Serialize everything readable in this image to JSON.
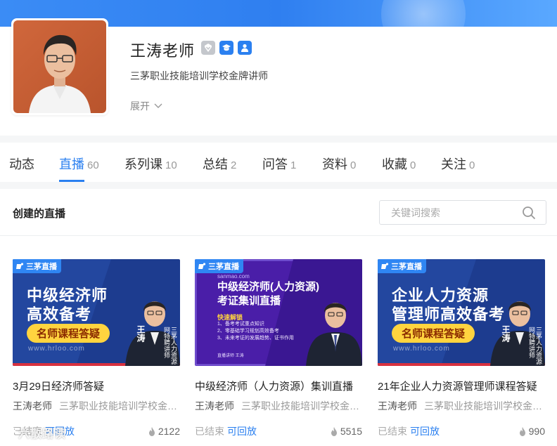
{
  "profile": {
    "name": "王涛老师",
    "bio": "三茅职业技能培训学校金牌讲师",
    "expand_label": "展开"
  },
  "tabs": [
    {
      "label": "动态",
      "count": ""
    },
    {
      "label": "直播",
      "count": "60"
    },
    {
      "label": "系列课",
      "count": "10"
    },
    {
      "label": "总结",
      "count": "2"
    },
    {
      "label": "问答",
      "count": "1"
    },
    {
      "label": "资料",
      "count": "0"
    },
    {
      "label": "收藏",
      "count": "0"
    },
    {
      "label": "关注",
      "count": "0"
    }
  ],
  "active_tab": "直播",
  "section": {
    "title": "创建的直播",
    "search_placeholder": "关键词搜索"
  },
  "cards": [
    {
      "tag": "三茅直播",
      "thumb_title_lines": [
        "中级经济师",
        "高效备考"
      ],
      "thumb_pill": "名师课程答疑",
      "thumb_site": "www.hrloo.com",
      "thumb_teacher": "王涛",
      "thumb_role": "三茅人力资源网特聘讲师",
      "title": "3月29日经济师答疑",
      "author": "王涛老师",
      "school": "三茅职业技能培训学校金牌讲师",
      "status": "已结束",
      "replay": "可回放",
      "heat": "2122"
    },
    {
      "tag": "三茅直播",
      "thumb_url": "sanmao.com",
      "thumb_title_lines": [
        "中级经济师(人力资源)",
        "考证集训直播"
      ],
      "thumb_sub": "快速解锁",
      "thumb_lines": [
        "1、备考考试重点知识",
        "2、零基础学习规划高效备考",
        "3、未来考证的发展趋势、证书作用"
      ],
      "thumb_footer": "直播讲师  王涛",
      "title": "中级经济师（人力资源）集训直播",
      "author": "王涛老师",
      "school": "三茅职业技能培训学校金牌讲师",
      "status": "已结束",
      "replay": "可回放",
      "heat": "5515"
    },
    {
      "tag": "三茅直播",
      "thumb_title_lines": [
        "企业人力资源",
        "管理师高效备考"
      ],
      "thumb_pill": "名师课程答疑",
      "thumb_site": "www.hrloo.com",
      "thumb_teacher": "王涛",
      "thumb_role": "三茅人力资源网特聘讲师",
      "title": "21年企业人力资源管理师课程答疑",
      "author": "王涛老师",
      "school": "三茅职业技能培训学校金牌讲师",
      "status": "已结束",
      "replay": "可回放",
      "heat": "990"
    }
  ],
  "watermark": "六散路读",
  "colors": {
    "accent": "#2b80f0",
    "banner": "#3b8cf5",
    "pill": "#ffd43f",
    "thumb_blue": "#1d3c8f",
    "thumb_purple": "#4a1ea8"
  }
}
